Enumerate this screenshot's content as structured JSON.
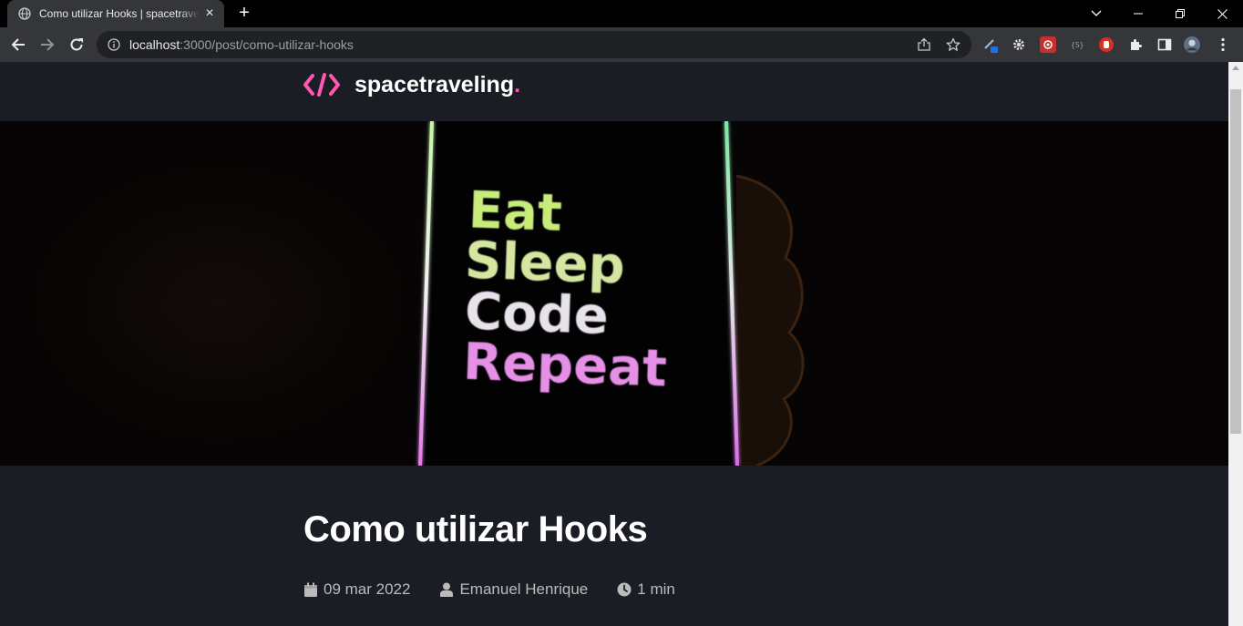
{
  "browser": {
    "tab_title": "Como utilizar Hooks | spacetraveling",
    "tab_close": "×",
    "new_tab": "+",
    "url_host": "localhost",
    "url_rest": ":3000/post/como-utilizar-hooks"
  },
  "site": {
    "logo_name": "spacetraveling",
    "logo_dot": ".",
    "accent_color": "#ff57b2",
    "background_color": "#1a1d23"
  },
  "banner": {
    "lines": [
      "Eat",
      "Sleep",
      "Code",
      "Repeat"
    ]
  },
  "post": {
    "title": "Como utilizar Hooks",
    "date": "09 mar 2022",
    "author": "Emanuel Henrique",
    "reading_time": "1 min"
  },
  "icons": {
    "date": "calendar-icon",
    "author": "user-icon",
    "reading_time": "clock-icon"
  }
}
